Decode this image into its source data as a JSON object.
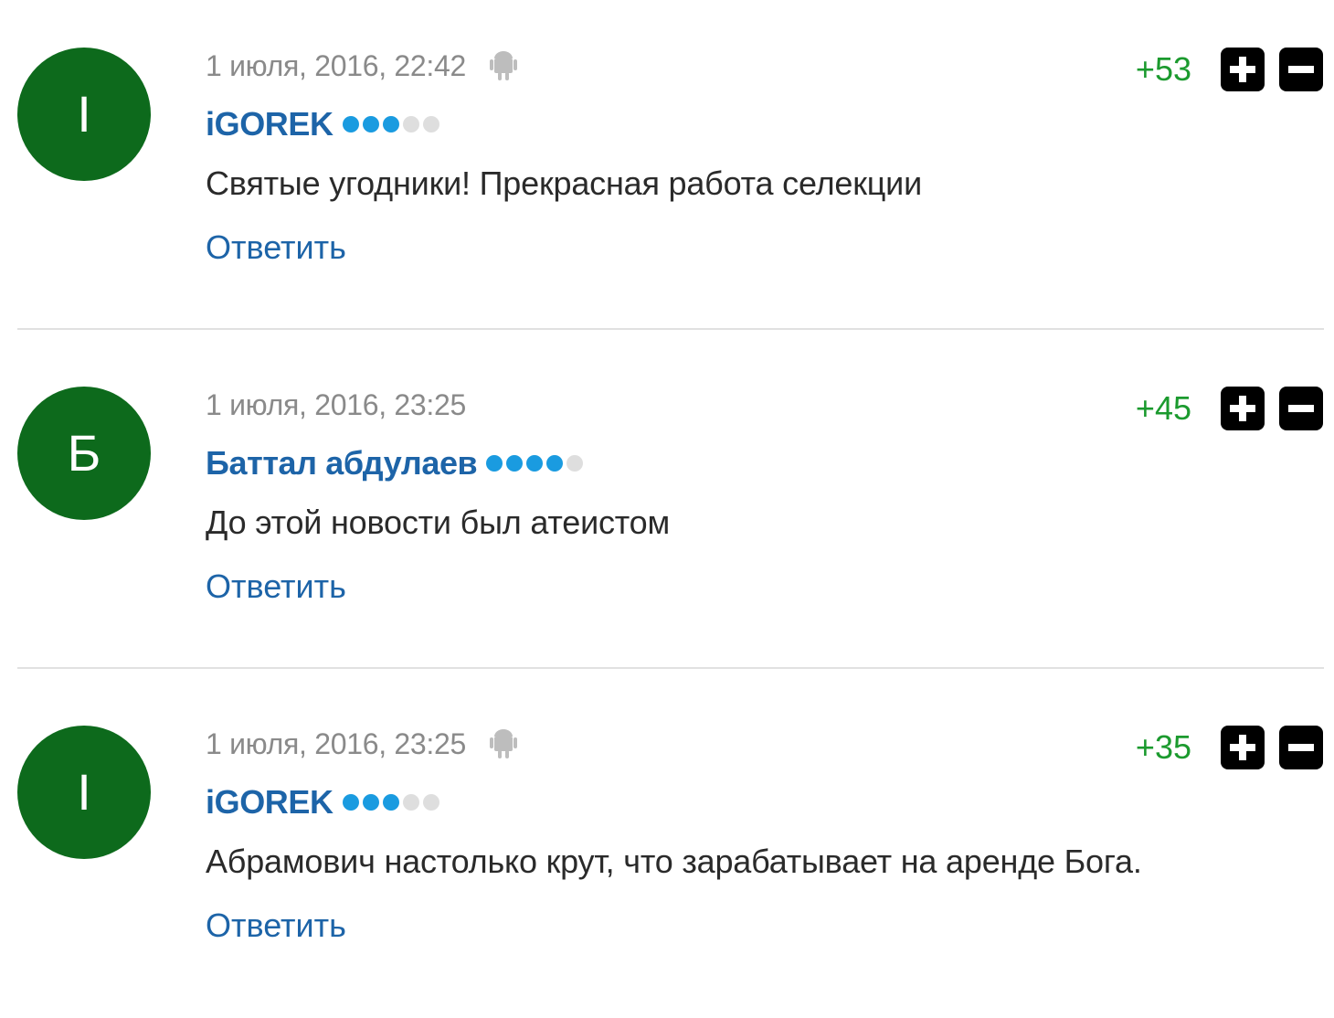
{
  "comments": [
    {
      "avatar_letter": "I",
      "date": "1 июля, 2016, 22:42",
      "has_android_icon": true,
      "author": "iGOREK",
      "rating_dots": [
        true,
        true,
        true,
        false,
        false
      ],
      "text": "Святые угодники! Прекрасная работа селекции",
      "reply_label": "Ответить",
      "score": "+53"
    },
    {
      "avatar_letter": "Б",
      "date": "1 июля, 2016, 23:25",
      "has_android_icon": false,
      "author": "Баттал абдулаев",
      "rating_dots": [
        true,
        true,
        true,
        true,
        false
      ],
      "text": "До этой новости был атеистом",
      "reply_label": "Ответить",
      "score": "+45"
    },
    {
      "avatar_letter": "I",
      "date": "1 июля, 2016, 23:25",
      "has_android_icon": true,
      "author": "iGOREK",
      "rating_dots": [
        true,
        true,
        true,
        false,
        false
      ],
      "text": "Абрамович настолько крут, что зарабатывает на аренде Бога.",
      "reply_label": "Ответить",
      "score": "+35"
    }
  ],
  "colors": {
    "avatar_bg": "#0d6a1c",
    "author": "#1d64a8",
    "score_positive": "#1b9a2e",
    "dot_active": "#1a9be0",
    "dot_inactive": "#dedede"
  },
  "icons": {
    "device": "android-icon",
    "upvote": "plus-icon",
    "downvote": "minus-icon"
  }
}
